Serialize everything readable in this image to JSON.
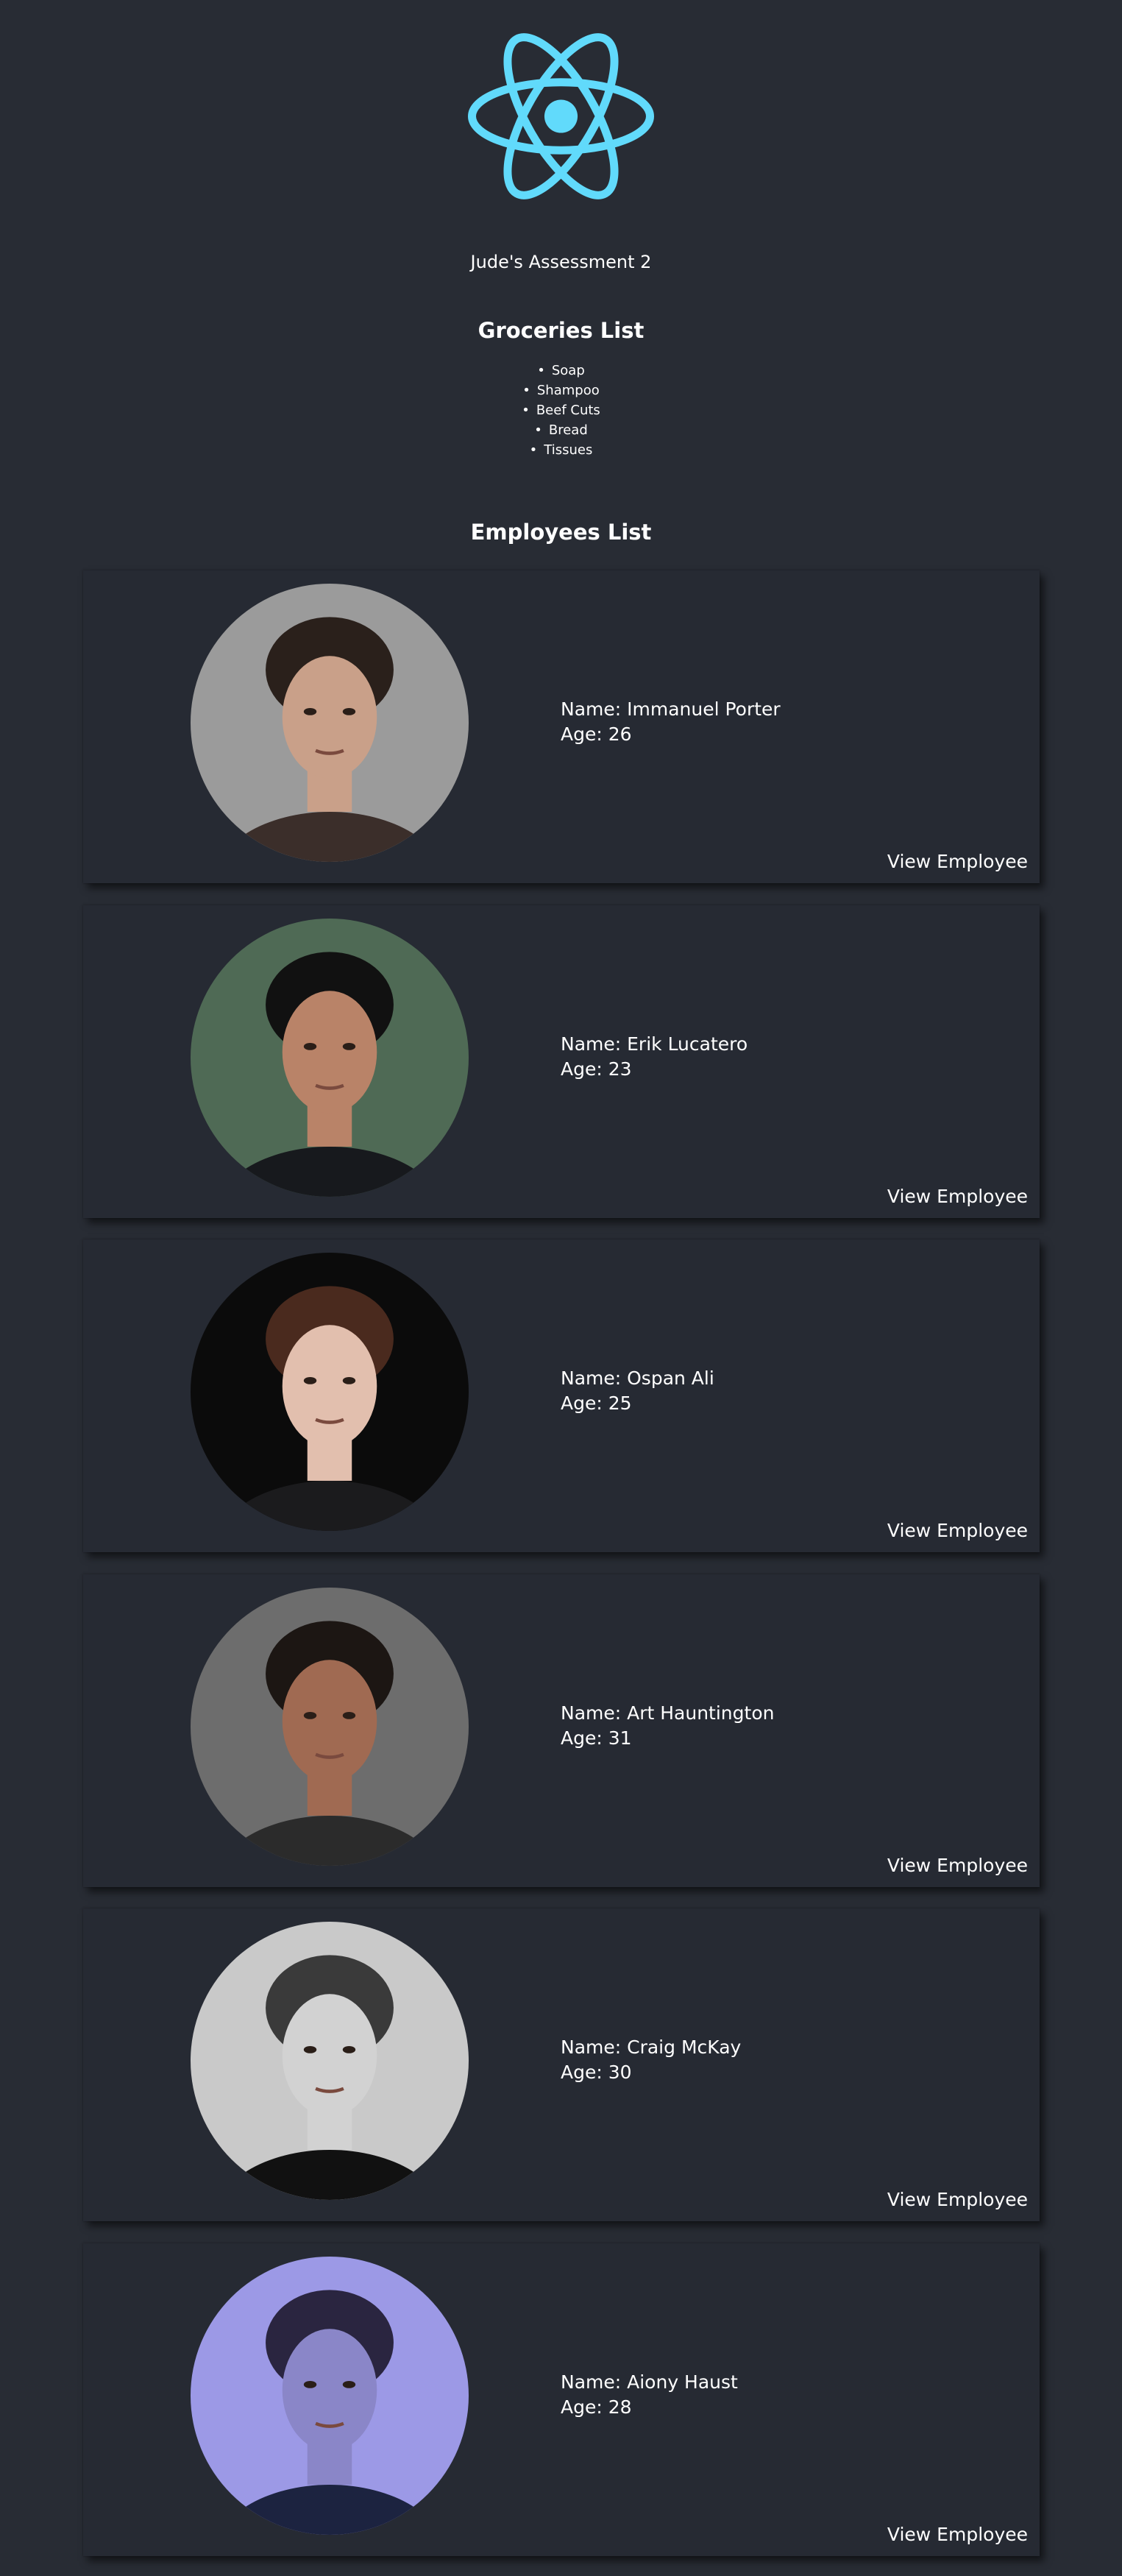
{
  "app": {
    "title": "Jude's Assessment 2",
    "logo_icon": "react-atom-icon",
    "accent_color": "#61dafb"
  },
  "groceries": {
    "title": "Groceries List",
    "items": [
      "Soap",
      "Shampoo",
      "Beef Cuts",
      "Bread",
      "Tissues"
    ]
  },
  "employees": {
    "title": "Employees List",
    "button_label": "View Employee",
    "list": [
      {
        "name": "Name: Immanuel Porter",
        "age": "Age: 26",
        "photo_bg": "#9b9b9b",
        "hair": "#2a201b",
        "skin": "#c9a089",
        "shirt": "#3b2e2a"
      },
      {
        "name": "Name: Erik Lucatero",
        "age": "Age: 23",
        "photo_bg": "#4f6a55",
        "hair": "#111111",
        "skin": "#b98368",
        "shirt": "#17191d"
      },
      {
        "name": "Name: Ospan Ali",
        "age": "Age: 25",
        "photo_bg": "#0b0b0b",
        "hair": "#4a2a1e",
        "skin": "#e2bfae",
        "shirt": "#1b1b1d"
      },
      {
        "name": "Name: Art Hauntington",
        "age": "Age: 31",
        "photo_bg": "#6d6d6d",
        "hair": "#1c1613",
        "skin": "#a06a52",
        "shirt": "#2b2b2b"
      },
      {
        "name": "Name: Craig McKay",
        "age": "Age: 30",
        "photo_bg": "#c9c9c9",
        "hair": "#3a3a3a",
        "skin": "#d2d2d2",
        "shirt": "#111111"
      },
      {
        "name": "Name: Aiony Haust",
        "age": "Age: 28",
        "photo_bg": "#9c99e6",
        "hair": "#2a2540",
        "skin": "#8a86c8",
        "shirt": "#1c2340"
      }
    ]
  }
}
